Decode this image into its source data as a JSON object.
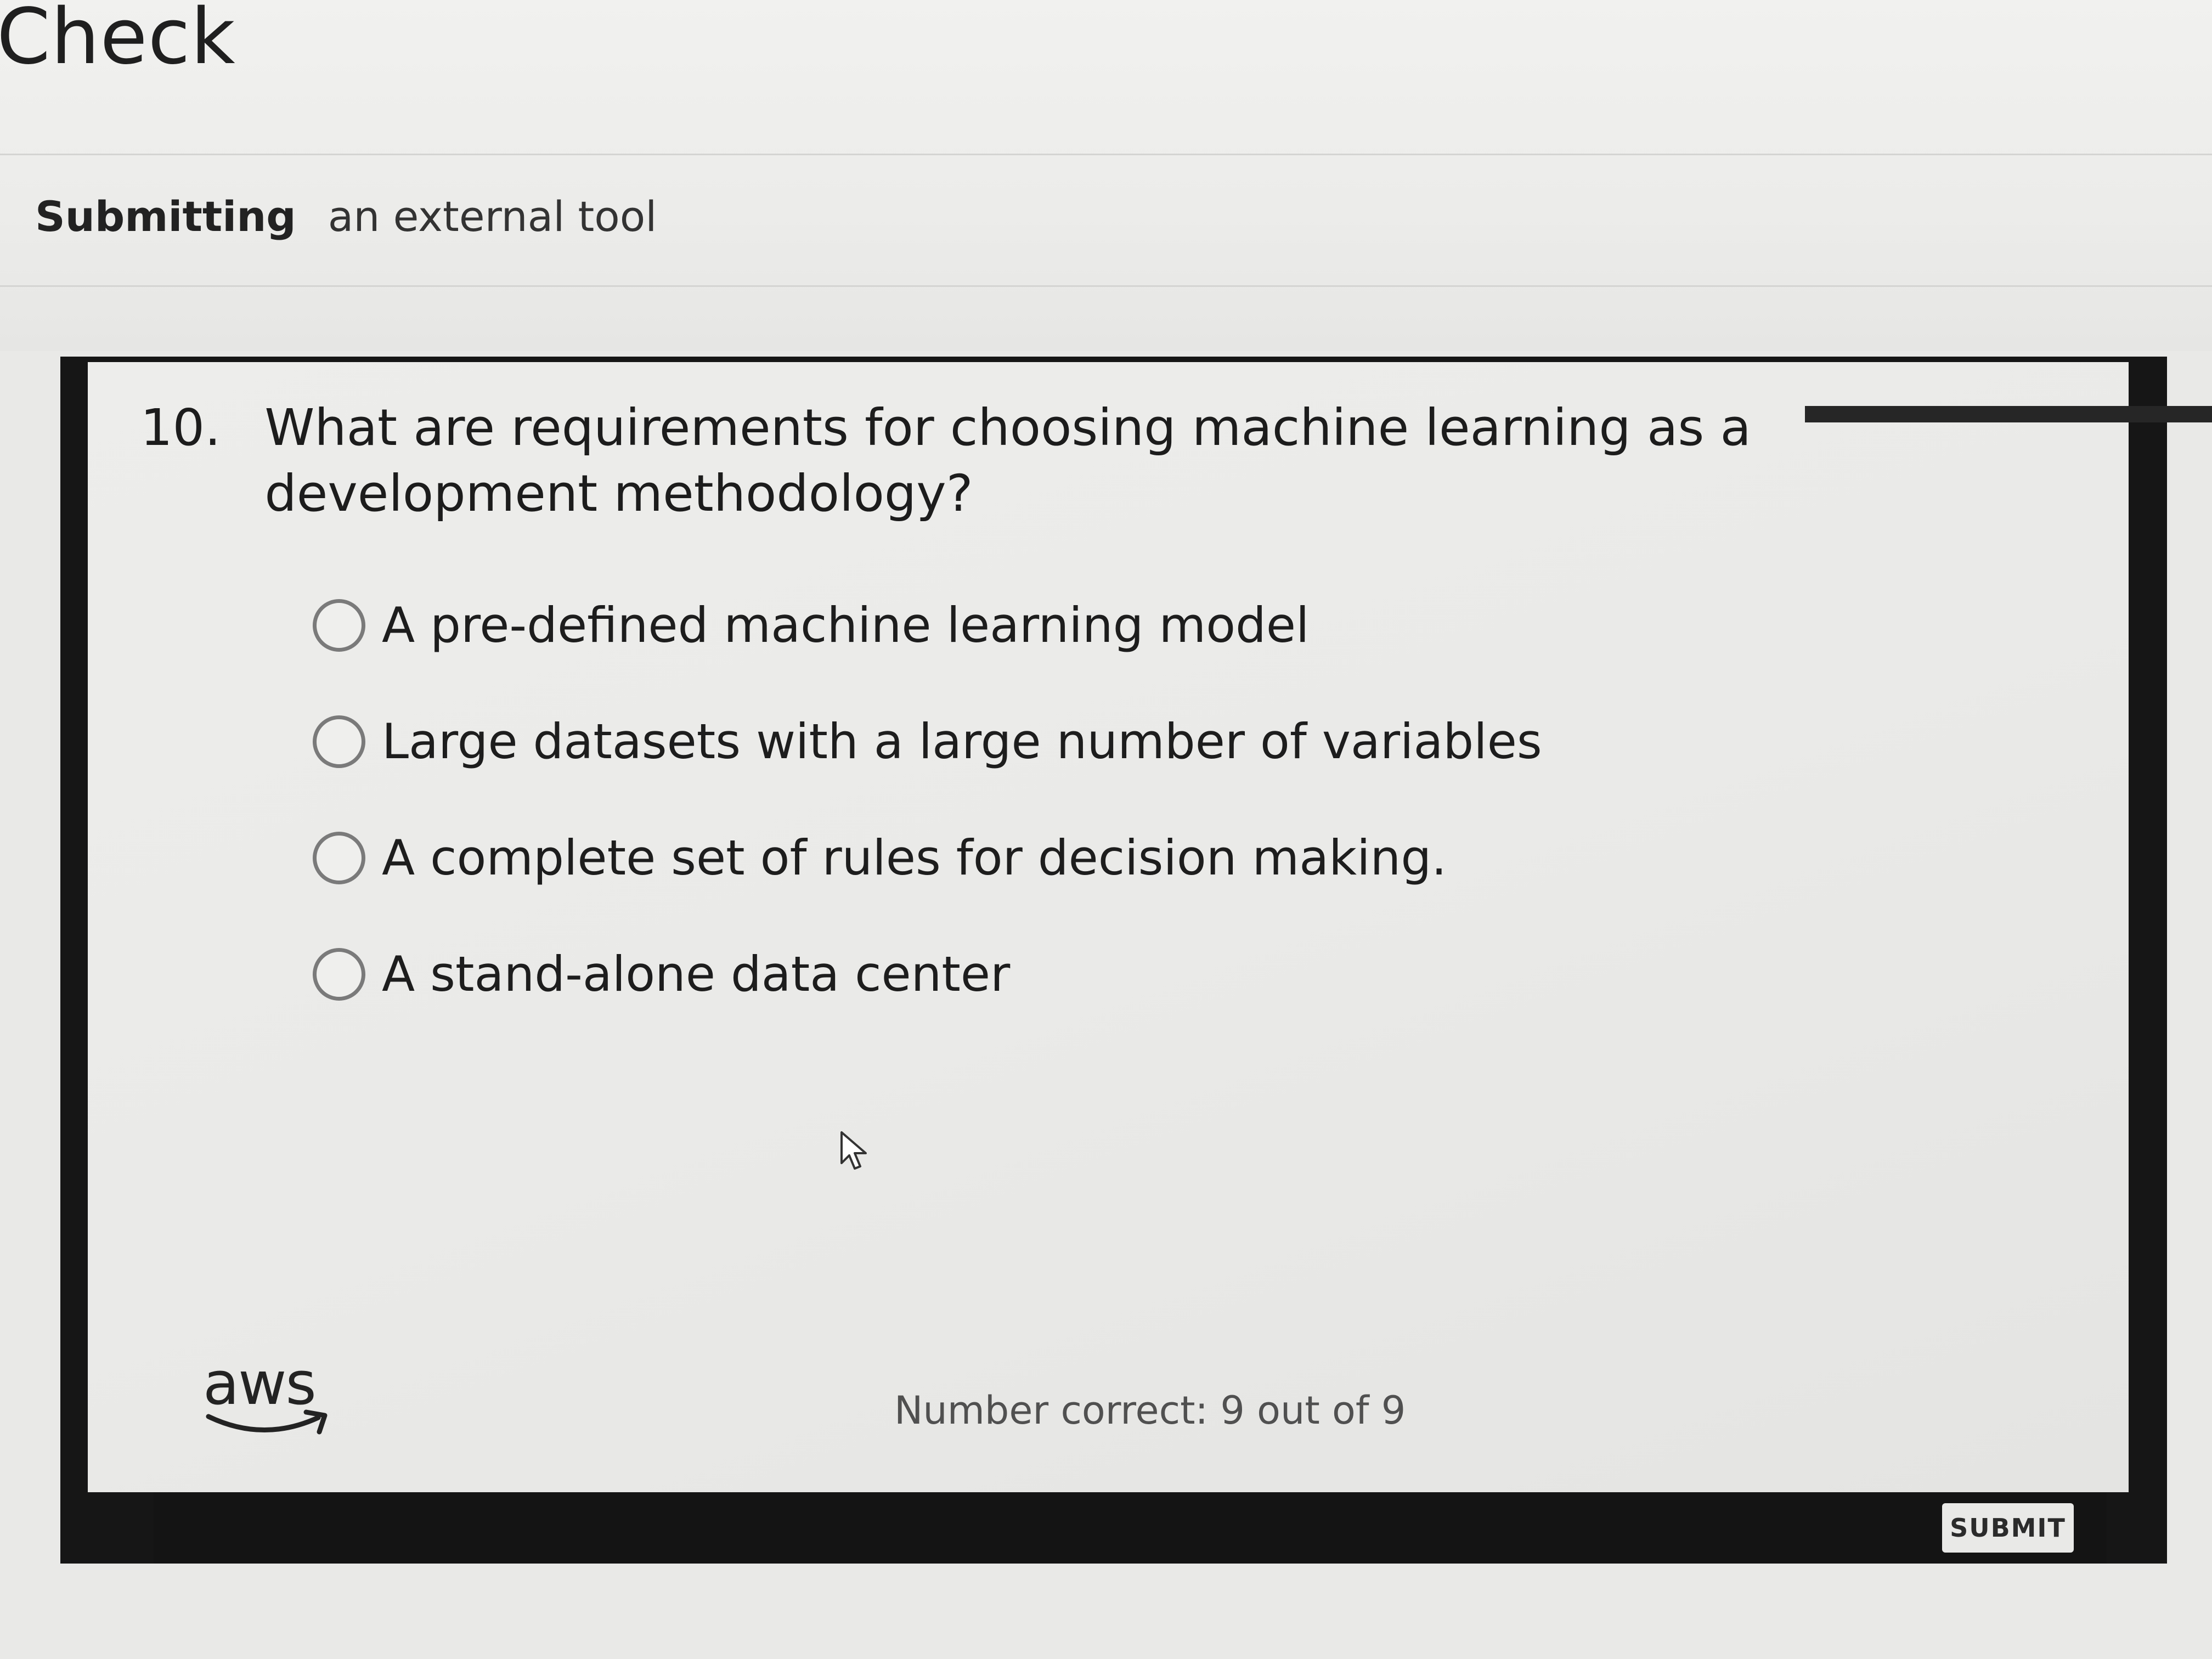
{
  "header": {
    "title": "Check",
    "submitting_label": "Submitting",
    "submitting_value": "an external tool"
  },
  "question": {
    "number": "10.",
    "text": "What are requirements for choosing machine learning as a development methodology?",
    "options": [
      {
        "label": "A pre-defined machine learning model"
      },
      {
        "label": "Large datasets with a large number of variables"
      },
      {
        "label": "A complete set of rules for decision making."
      },
      {
        "label": "A stand-alone data center"
      }
    ]
  },
  "footer": {
    "logo_text": "aws",
    "score_text": "Number correct: 9 out of 9",
    "submit_label": "SUBMIT"
  },
  "icons": {
    "radio": "radio-unselected-icon",
    "cursor": "mouse-pointer-icon",
    "logo": "aws-smile-icon"
  },
  "colors": {
    "frame": "#161616",
    "panel": "#ececea",
    "text": "#1c1c1c"
  }
}
